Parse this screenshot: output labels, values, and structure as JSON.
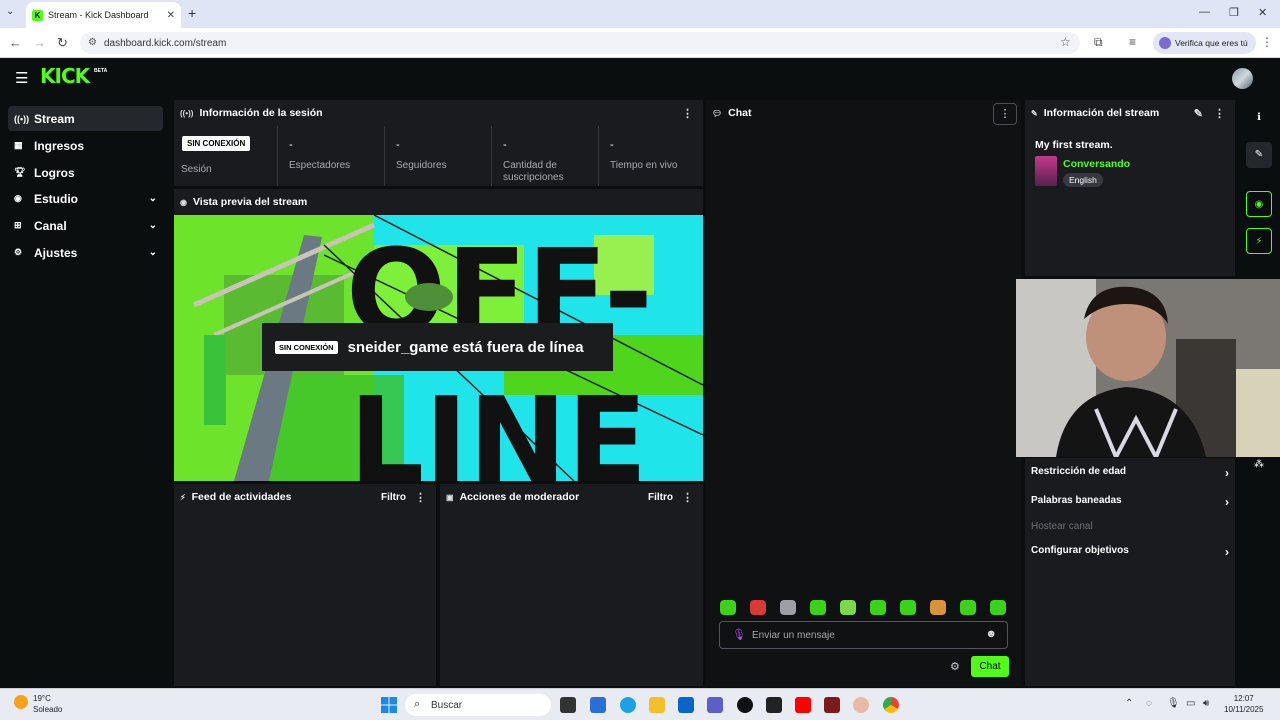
{
  "browser": {
    "tab_title": "Stream - Kick Dashboard",
    "favicon_letter": "K",
    "url": "dashboard.kick.com/stream",
    "verify_label": "Verifica que eres tú"
  },
  "header": {
    "logo": "KICK",
    "beta": "BETA"
  },
  "sidebar": {
    "items": [
      {
        "label": "Stream",
        "icon": "antenna-icon",
        "active": true
      },
      {
        "label": "Ingresos",
        "icon": "money-icon"
      },
      {
        "label": "Logros",
        "icon": "trophy-icon"
      },
      {
        "label": "Estudio",
        "icon": "studio-icon",
        "expandable": true
      },
      {
        "label": "Canal",
        "icon": "channel-icon",
        "expandable": true
      },
      {
        "label": "Ajustes",
        "icon": "gear-icon",
        "expandable": true
      }
    ]
  },
  "session": {
    "title": "Información de la sesión",
    "status_badge": "SIN CONEXIÓN",
    "stats": [
      {
        "value": "",
        "label": "Sesión"
      },
      {
        "value": "-",
        "label": "Espectadores"
      },
      {
        "value": "-",
        "label": "Seguidores"
      },
      {
        "value": "-",
        "label": "Cantidad de suscripciones"
      },
      {
        "value": "-",
        "label": "Tiempo en vivo"
      }
    ]
  },
  "preview": {
    "title": "Vista previa del stream",
    "badge": "SIN CONEXIÓN",
    "message": "sneider_game está fuera de línea",
    "bg_text_1": "OFF-",
    "bg_text_2": "LINE"
  },
  "activity": {
    "title": "Feed de actividades",
    "filter": "Filtro"
  },
  "moderator": {
    "title": "Acciones de moderador",
    "filter": "Filtro"
  },
  "chat": {
    "title": "Chat",
    "placeholder": "Enviar un mensaje",
    "send_label": "Chat",
    "emote_count": 10
  },
  "stream_info": {
    "title": "Información del stream",
    "stream_title": "My first stream.",
    "category": "Conversando",
    "language": "English"
  },
  "settings": {
    "rows": [
      {
        "label": "Restricción de edad",
        "enabled": true
      },
      {
        "label": "Palabras baneadas",
        "enabled": true
      },
      {
        "label": "Hostear canal",
        "enabled": false
      },
      {
        "label": "Configurar objetivos",
        "enabled": true
      }
    ]
  },
  "taskbar": {
    "temperature": "19°C",
    "weather": "Soleado",
    "search_placeholder": "Buscar",
    "time": "12:07",
    "date": "10/11/2025"
  },
  "colors": {
    "accent": "#53fc18",
    "panel": "#191b1f",
    "background": "#0b0e0f"
  }
}
